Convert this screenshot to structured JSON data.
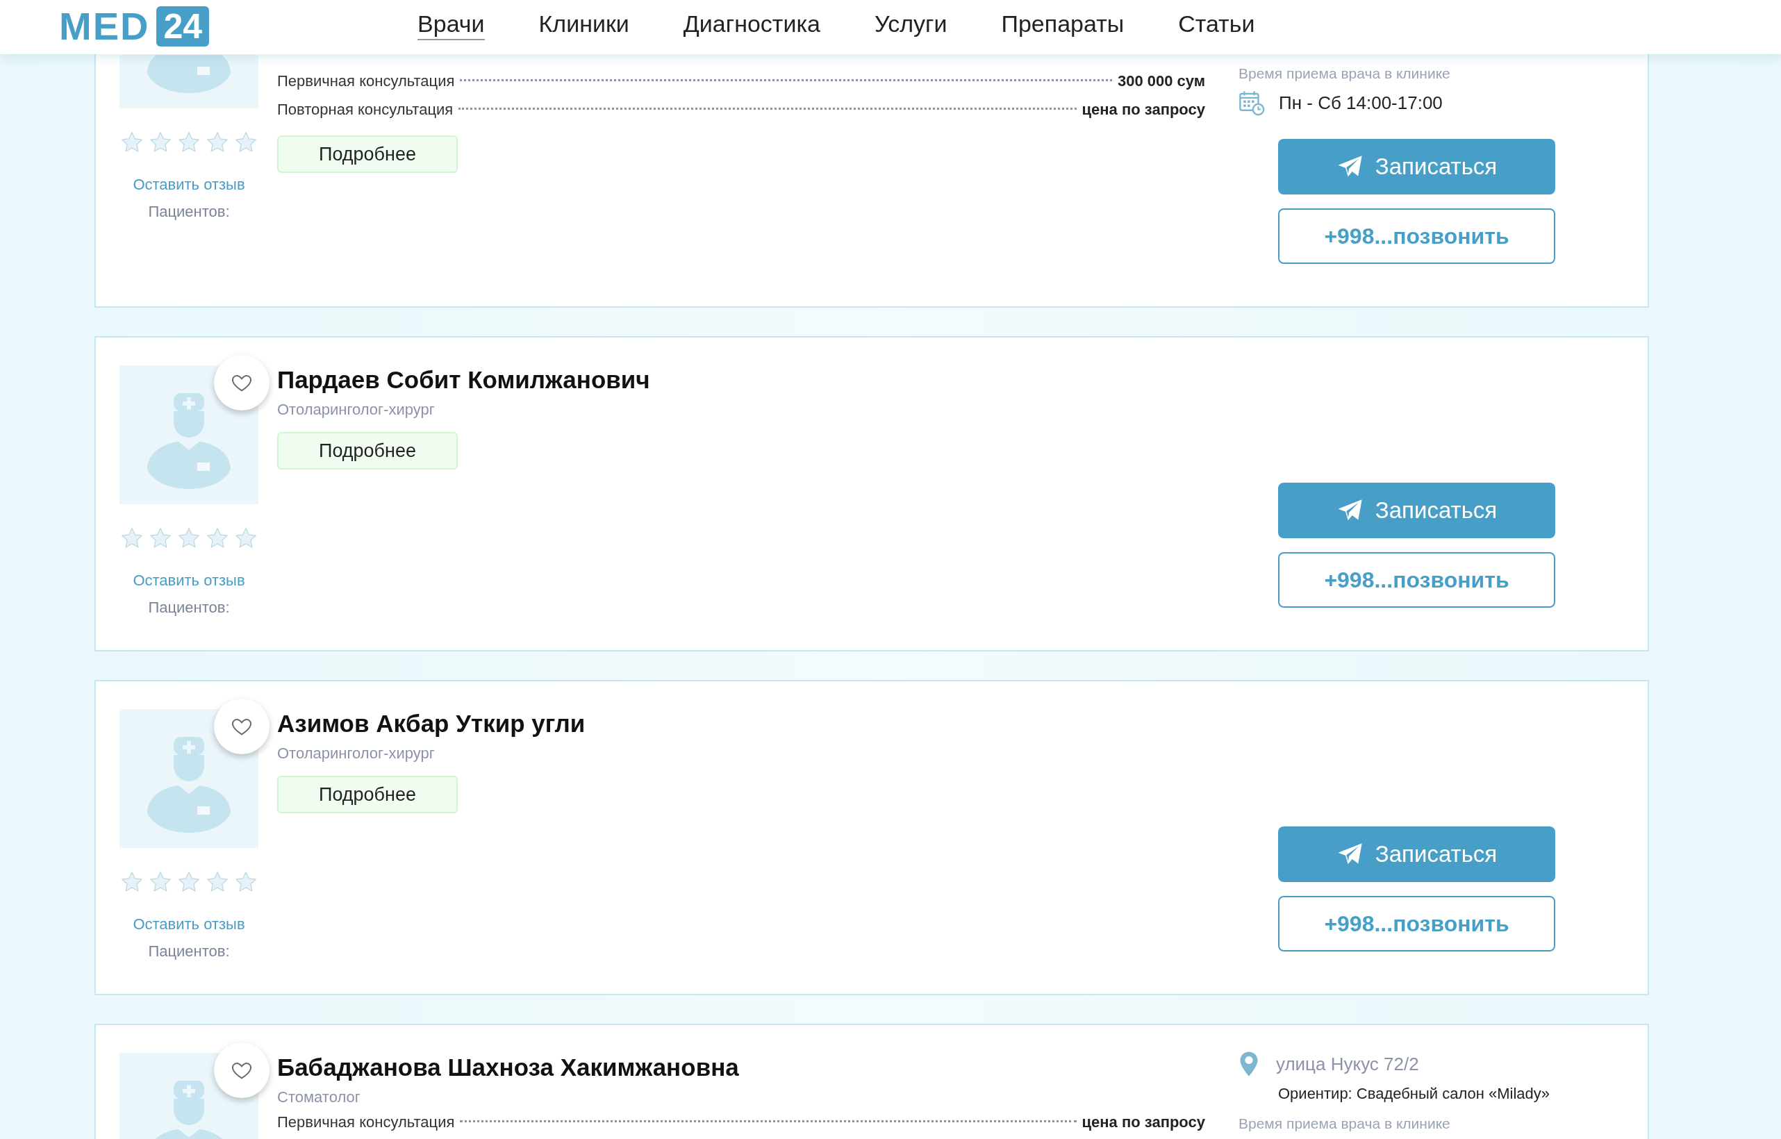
{
  "header": {
    "logo": {
      "text": "MED",
      "badge": "24"
    },
    "nav": [
      {
        "label": "Врачи",
        "selected": true
      },
      {
        "label": "Клиники",
        "selected": false
      },
      {
        "label": "Диагностика",
        "selected": false
      },
      {
        "label": "Услуги",
        "selected": false
      },
      {
        "label": "Препараты",
        "selected": false
      },
      {
        "label": "Статьи",
        "selected": false
      }
    ]
  },
  "doctors": [
    {
      "prices": [
        {
          "label": "Первичная консультация",
          "value": "300 000 сум"
        },
        {
          "label": "Повторная консультация",
          "value": "цена по запросу"
        }
      ],
      "details_button": "Подробнее",
      "stars": 0,
      "review_link": "Оставить отзыв",
      "patients_label": "Пациентов:",
      "schedule_label": "Время приема врача в клинике",
      "schedule": "Пн - Сб 14:00-17:00",
      "book_button": "Записаться",
      "call_button": "+998...позвонить"
    },
    {
      "favorite": false,
      "name": "Пардаев Собит Комилжанович",
      "specialty": "Отоларинголог-хирург",
      "details_button": "Подробнее",
      "stars": 0,
      "review_link": "Оставить отзыв",
      "patients_label": "Пациентов:",
      "book_button": "Записаться",
      "call_button": "+998...позвонить"
    },
    {
      "favorite": false,
      "name": "Азимов Акбар Уткир угли",
      "specialty": "Отоларинголог-хирург",
      "details_button": "Подробнее",
      "stars": 0,
      "review_link": "Оставить отзыв",
      "patients_label": "Пациентов:",
      "book_button": "Записаться",
      "call_button": "+998...позвонить"
    },
    {
      "favorite": false,
      "name": "Бабаджанова Шахноза Хакимжановна",
      "specialty": "Стоматолог",
      "prices": [
        {
          "label": "Первичная консультация",
          "value": "цена по запросу"
        }
      ],
      "address": "улица Нукус 72/2",
      "landmark": "Ориентир: Свадебный салон «Milady»",
      "schedule_label": "Время приема врача в клинике"
    }
  ]
}
